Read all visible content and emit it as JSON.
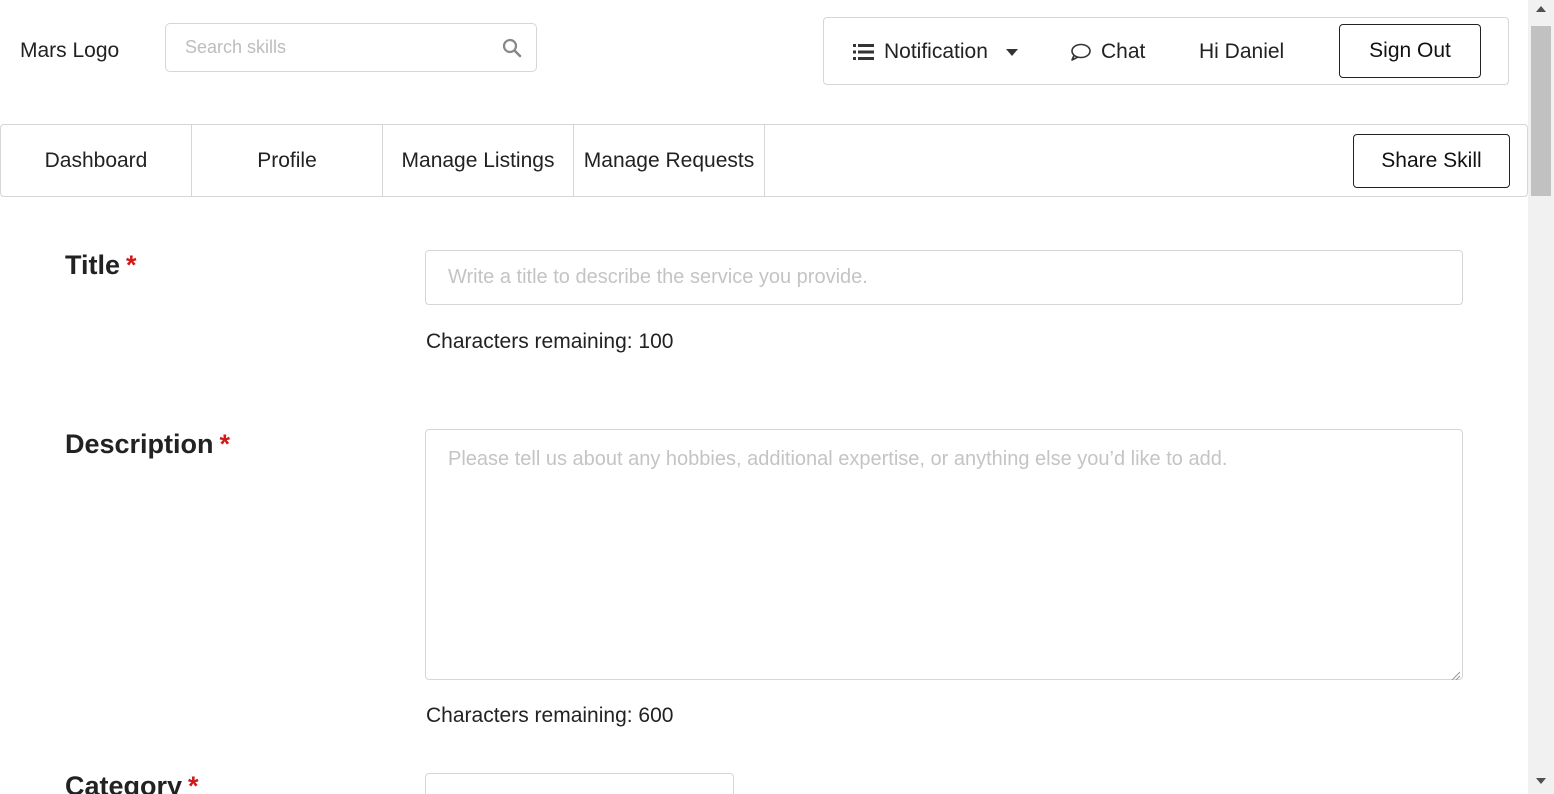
{
  "header": {
    "logo": "Mars Logo",
    "search_placeholder": "Search skills",
    "notification_label": "Notification",
    "chat_label": "Chat",
    "greeting": "Hi Daniel",
    "signout_label": "Sign Out"
  },
  "tabs": [
    {
      "label": "Dashboard"
    },
    {
      "label": "Profile"
    },
    {
      "label": "Manage Listings"
    },
    {
      "label": "Manage Requests"
    }
  ],
  "share_skill_label": "Share Skill",
  "form": {
    "required_mark": "*",
    "title": {
      "label": "Title",
      "placeholder": "Write a title to describe the service you provide.",
      "value": "",
      "counter": "Characters remaining: 100"
    },
    "description": {
      "label": "Description",
      "placeholder": "Please tell us about any hobbies, additional expertise, or anything else you’d like to add.",
      "value": "",
      "counter": "Characters remaining: 600"
    },
    "category": {
      "label": "Category"
    }
  },
  "colors": {
    "required": "#d01919",
    "border": "#d6d6d6",
    "text": "#222222",
    "placeholder": "#c4c4c4"
  },
  "icons": [
    "search-icon",
    "list-icon",
    "caret-down-icon",
    "chat-bubble-icon"
  ]
}
